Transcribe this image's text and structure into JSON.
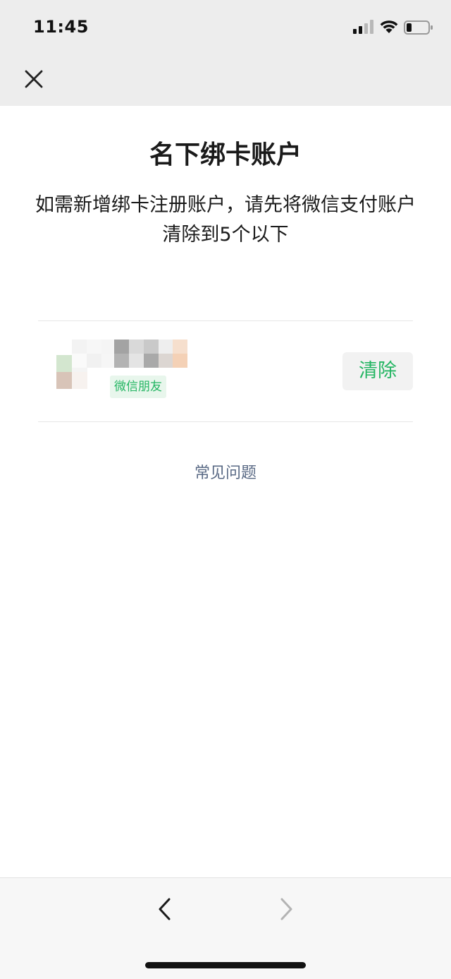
{
  "status_bar": {
    "time": "11:45"
  },
  "header": {
    "close_icon": "close-icon"
  },
  "page": {
    "title": "名下绑卡账户",
    "description": "如需新增绑卡注册账户，请先将微信支付账户清除到5个以下"
  },
  "account": {
    "tag": "微信朋友",
    "clear_label": "清除"
  },
  "faq": {
    "label": "常见问题"
  },
  "toolbar": {
    "back_icon": "chevron-left-icon",
    "forward_icon": "chevron-right-icon"
  },
  "colors": {
    "accent_green": "#23b562",
    "tag_background": "#e8f6ec",
    "link_blue_gray": "#5a6a85",
    "top_bar": "#ededed",
    "bottom_bar": "#f7f7f7"
  }
}
